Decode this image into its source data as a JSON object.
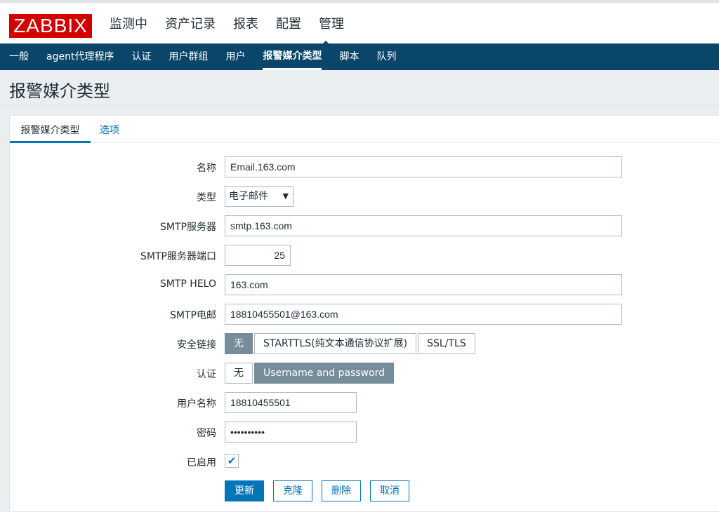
{
  "logo": "ZABBIX",
  "main_nav": [
    "监测中",
    "资产记录",
    "报表",
    "配置",
    "管理"
  ],
  "sub_nav": [
    "一般",
    "agent代理程序",
    "认证",
    "用户群组",
    "用户",
    "报警媒介类型",
    "脚本",
    "队列"
  ],
  "page_title": "报警媒介类型",
  "tabs": [
    "报警媒介类型",
    "选项"
  ],
  "form": {
    "name_label": "名称",
    "name_value": "Email.163.com",
    "type_label": "类型",
    "type_value": "电子邮件",
    "smtp_server_label": "SMTP服务器",
    "smtp_server_value": "smtp.163.com",
    "smtp_port_label": "SMTP服务器端口",
    "smtp_port_value": "25",
    "smtp_helo_label": "SMTP HELO",
    "smtp_helo_value": "163.com",
    "smtp_email_label": "SMTP电邮",
    "smtp_email_value": "18810455501@163.com",
    "security_label": "安全链接",
    "security_options": [
      "无",
      "STARTTLS(纯文本通信协议扩展)",
      "SSL/TLS"
    ],
    "auth_label": "认证",
    "auth_options": [
      "无",
      "Username and password"
    ],
    "username_label": "用户名称",
    "username_value": "18810455501",
    "password_label": "密码",
    "password_value": "••••••••••",
    "enabled_label": "已启用",
    "enabled_mark": "✔"
  },
  "buttons": {
    "update": "更新",
    "clone": "克隆",
    "delete": "删除",
    "cancel": "取消"
  },
  "colors": {
    "brand": "#d40000",
    "nav_bg": "#0a466a",
    "accent": "#0275b8",
    "segment_active": "#768d99"
  }
}
